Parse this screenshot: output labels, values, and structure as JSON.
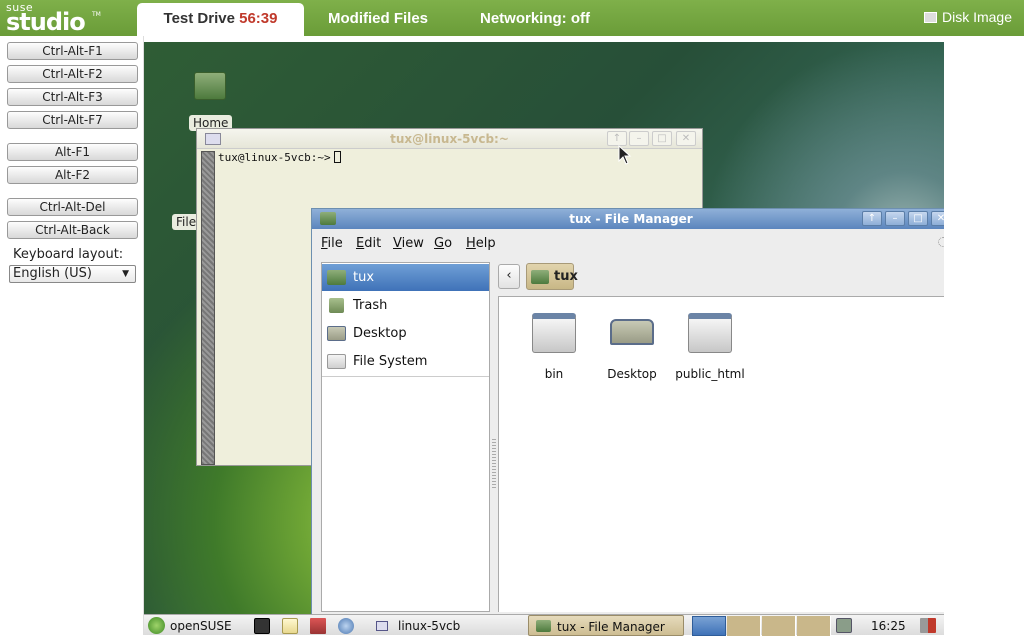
{
  "header": {
    "logo_top": "suse",
    "logo_main": "studio",
    "logo_tm": "TM",
    "tabs": [
      {
        "label": "Test Drive",
        "timer": "56:39"
      },
      {
        "label": "Modified Files"
      },
      {
        "label": "Networking: off"
      }
    ],
    "disk_image": "Disk Image"
  },
  "sidebar": {
    "keys": [
      "Ctrl-Alt-F1",
      "Ctrl-Alt-F2",
      "Ctrl-Alt-F3",
      "Ctrl-Alt-F7",
      "Alt-F1",
      "Alt-F2",
      "Ctrl-Alt-Del",
      "Ctrl-Alt-Back"
    ],
    "keyboard_layout_label": "Keyboard layout:",
    "keyboard_layout_value": "English (US)"
  },
  "desktop": {
    "icons": [
      {
        "label": "Home"
      },
      {
        "label": "File"
      }
    ]
  },
  "terminal": {
    "title": "tux@linux-5vcb:~",
    "prompt": "tux@linux-5vcb:~>"
  },
  "file_manager": {
    "title": "tux - File Manager",
    "menu": [
      {
        "mnemonic": "F",
        "rest": "ile"
      },
      {
        "mnemonic": "E",
        "rest": "dit"
      },
      {
        "mnemonic": "V",
        "rest": "iew"
      },
      {
        "mnemonic": "G",
        "rest": "o"
      },
      {
        "mnemonic": "H",
        "rest": "elp"
      }
    ],
    "places": [
      "tux",
      "Trash",
      "Desktop",
      "File System"
    ],
    "breadcrumb": "tux",
    "items": [
      "bin",
      "Desktop",
      "public_html"
    ]
  },
  "taskbar": {
    "start_label": "openSUSE",
    "tasks": [
      "linux-5vcb",
      "tux - File Manager"
    ],
    "clock": "16:25"
  },
  "colors": {
    "brand_green": "#6a9c38",
    "timer_red": "#c0392b",
    "selection_blue": "#3f72b8"
  }
}
